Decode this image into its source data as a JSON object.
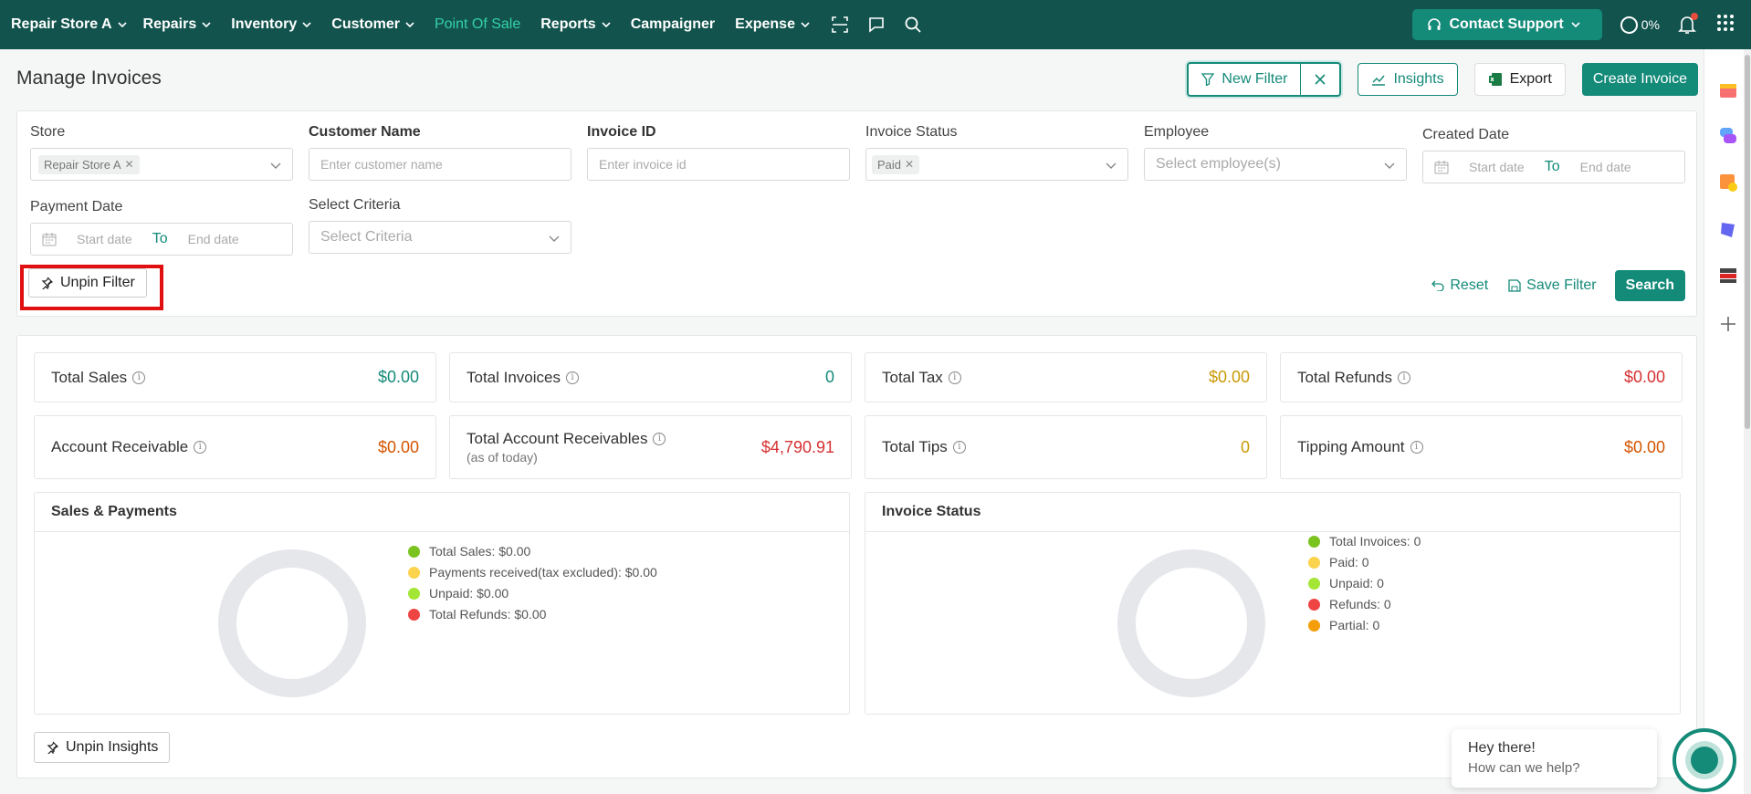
{
  "nav": {
    "store": "Repair Store A",
    "items": [
      {
        "label": "Repairs"
      },
      {
        "label": "Inventory"
      },
      {
        "label": "Customer"
      },
      {
        "label": "Point Of Sale"
      },
      {
        "label": "Reports"
      },
      {
        "label": "Campaigner"
      },
      {
        "label": "Expense"
      }
    ],
    "contact_support": "Contact Support",
    "progress": "0%"
  },
  "header": {
    "title": "Manage Invoices",
    "new_filter": "New Filter",
    "insights": "Insights",
    "export": "Export",
    "create_invoice": "Create Invoice"
  },
  "filters": {
    "store": {
      "label": "Store",
      "tag": "Repair Store A"
    },
    "customer_name": {
      "label": "Customer Name",
      "placeholder": "Enter customer name"
    },
    "invoice_id": {
      "label": "Invoice ID",
      "placeholder": "Enter invoice id"
    },
    "invoice_status": {
      "label": "Invoice Status",
      "tag": "Paid"
    },
    "employee": {
      "label": "Employee",
      "placeholder": "Select employee(s)"
    },
    "created_date": {
      "label": "Created Date",
      "start": "Start date",
      "to": "To",
      "end": "End date"
    },
    "payment_date": {
      "label": "Payment Date",
      "start": "Start date",
      "to": "To",
      "end": "End date"
    },
    "criteria": {
      "label": "Select Criteria",
      "placeholder": "Select Criteria"
    },
    "unpin": "Unpin Filter",
    "reset": "Reset",
    "save": "Save Filter",
    "search": "Search"
  },
  "stats": [
    {
      "label": "Total Sales",
      "value": "$0.00",
      "color": "#148a79"
    },
    {
      "label": "Total Invoices",
      "value": "0",
      "color": "#148a79"
    },
    {
      "label": "Total Tax",
      "value": "$0.00",
      "color": "#c99a07"
    },
    {
      "label": "Total Refunds",
      "value": "$0.00",
      "color": "#d63031"
    },
    {
      "label": "Account Receivable",
      "value": "$0.00",
      "color": "#d35400"
    },
    {
      "label": "Total Account Receivables",
      "sub": "(as of today)",
      "value": "$4,790.91",
      "color": "#d63031"
    },
    {
      "label": "Total Tips",
      "value": "0",
      "color": "#c99a07"
    },
    {
      "label": "Tipping Amount",
      "value": "$0.00",
      "color": "#d35400"
    }
  ],
  "sales_payments": {
    "title": "Sales & Payments",
    "legend": [
      {
        "label": "Total Sales: $0.00",
        "color": "#7bc31f"
      },
      {
        "label": "Payments received(tax excluded): $0.00",
        "color": "#fcd34d"
      },
      {
        "label": "Unpaid: $0.00",
        "color": "#a3e635"
      },
      {
        "label": "Total Refunds: $0.00",
        "color": "#ef4444"
      }
    ]
  },
  "invoice_status": {
    "title": "Invoice Status",
    "legend": [
      {
        "label": "Total Invoices: 0",
        "color": "#7bc31f"
      },
      {
        "label": "Paid: 0",
        "color": "#fcd34d"
      },
      {
        "label": "Unpaid: 0",
        "color": "#a3e635"
      },
      {
        "label": "Refunds: 0",
        "color": "#ef4444"
      },
      {
        "label": "Partial: 0",
        "color": "#f59e0b"
      }
    ]
  },
  "unpin_insights": "Unpin Insights",
  "chat": {
    "line1": "Hey there!",
    "line2": "How can we help?"
  }
}
